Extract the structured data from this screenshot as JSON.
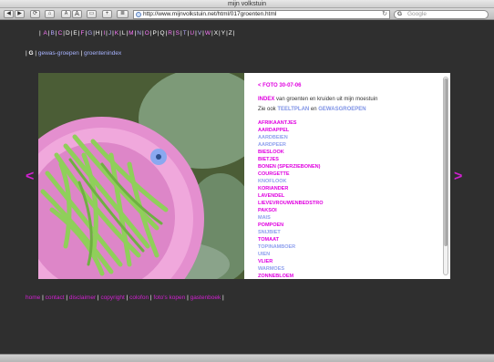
{
  "window": {
    "title": "mijn volkstuin"
  },
  "toolbar": {
    "back": "◀",
    "forward": "▶",
    "reload": "⟳",
    "home": "⌂",
    "font_small": "A",
    "font_large": "A",
    "print": "▭",
    "add": "+",
    "feed": "≣",
    "url": "http://www.mijnvolkstuin.net/html/017groenten.html",
    "search_placeholder": "Google",
    "search_g": "G"
  },
  "alphabet": [
    "A",
    "B",
    "C",
    "D",
    "E",
    "F",
    "G",
    "H",
    "I",
    "J",
    "K",
    "L",
    "M",
    "N",
    "O",
    "P",
    "Q",
    "R",
    "S",
    "T",
    "U",
    "V",
    "W",
    "X",
    "Y",
    "Z"
  ],
  "alphabet_colors": {
    "A": "#ff77ff",
    "B": "#b6a8ff",
    "C": "#ff77ff",
    "D": "#ffffff",
    "E": "#ffffff",
    "F": "#ff77ff",
    "G": "#b6a8ff",
    "H": "#ffffff",
    "I": "#ff77ff",
    "J": "#b6a8ff",
    "K": "#ff77ff",
    "L": "#ffffff",
    "M": "#ff77ff",
    "N": "#b6a8ff",
    "O": "#ff77ff",
    "P": "#ffffff",
    "Q": "#ffffff",
    "R": "#ff77ff",
    "S": "#ff77ff",
    "T": "#b6a8ff",
    "U": "#ff77ff",
    "V": "#b6a8ff",
    "W": "#ff77ff",
    "X": "#ffffff",
    "Y": "#ffffff",
    "Z": "#ffffff"
  },
  "breadcrumb": {
    "letter": "G",
    "link1": "gewas-groepen",
    "link2": "groentenindex"
  },
  "nav": {
    "prev": "<",
    "next": ">"
  },
  "panel": {
    "foto_link": "< FOTO 30-07-06",
    "index_label": "INDEX",
    "index_text": " van groenten en kruiden uit mijn moestuin",
    "zie_ook": "Zie ook ",
    "teeltplan": "TEELTPLAN",
    "en": " en ",
    "gewasgroepen": "GEWASGROEPEN"
  },
  "vegetables": [
    {
      "name": "AFRIKAANTJES",
      "color": "#e000e0"
    },
    {
      "name": "AARDAPPEL",
      "color": "#e000e0"
    },
    {
      "name": "AARDBEIEN",
      "color": "#8fa0ee"
    },
    {
      "name": "AARDPEER",
      "color": "#8fa0ee"
    },
    {
      "name": "BIESLOOK",
      "color": "#e000e0"
    },
    {
      "name": "BIETJES",
      "color": "#e000e0"
    },
    {
      "name": "BONEN (SPERZIEBONEN)",
      "color": "#e000e0"
    },
    {
      "name": "COURGETTE",
      "color": "#e000e0"
    },
    {
      "name": "KNOFLOOK",
      "color": "#8fa0ee"
    },
    {
      "name": "KORIANDER",
      "color": "#e000e0"
    },
    {
      "name": "LAVENDEL",
      "color": "#e000e0"
    },
    {
      "name": "LIEVEVROUWENBEDSTRO",
      "color": "#e000e0"
    },
    {
      "name": "PAKSOI",
      "color": "#e000e0"
    },
    {
      "name": "MAIS",
      "color": "#8fa0ee"
    },
    {
      "name": "POMPOEN",
      "color": "#e000e0"
    },
    {
      "name": "SNIJBIET",
      "color": "#8fa0ee"
    },
    {
      "name": "TOMAAT",
      "color": "#e000e0"
    },
    {
      "name": "TOPINAMBOER",
      "color": "#8fa0ee"
    },
    {
      "name": "UIEN",
      "color": "#8fa0ee"
    },
    {
      "name": "VLIER",
      "color": "#e000e0"
    },
    {
      "name": "WARMOES",
      "color": "#8fa0ee"
    },
    {
      "name": "ZONNEBLOEM",
      "color": "#e000e0"
    }
  ],
  "footer": [
    "home",
    "contact",
    "disclaimer",
    "copyright",
    "colofon",
    "foto's kopen",
    "gastenboek"
  ],
  "colors": {
    "accent": "#d020d0",
    "link_blue": "#a8b4ff",
    "background": "#2f2f2f"
  }
}
